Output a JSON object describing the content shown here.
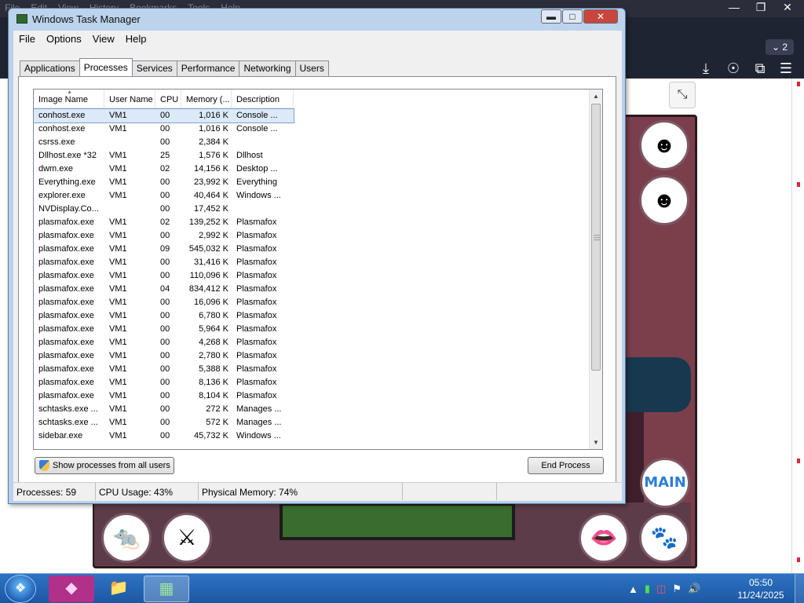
{
  "browser": {
    "menu": [
      "File",
      "Edit",
      "View",
      "History",
      "Bookmarks",
      "Tools",
      "Help"
    ],
    "tab_count": "2",
    "toolbar_icons": [
      "download-icon",
      "account-icon",
      "extensions-icon",
      "menu-icon"
    ]
  },
  "game": {
    "main_button_label": "MAIN"
  },
  "task_manager": {
    "title": "Windows Task Manager",
    "menu": [
      "File",
      "Options",
      "View",
      "Help"
    ],
    "tabs": [
      "Applications",
      "Processes",
      "Services",
      "Performance",
      "Networking",
      "Users"
    ],
    "active_tab": "Processes",
    "columns": [
      "Image Name",
      "User Name",
      "CPU",
      "Memory (...",
      "Description"
    ],
    "rows": [
      {
        "image": "conhost.exe",
        "user": "VM1",
        "cpu": "00",
        "memory": "1,016 K",
        "description": "Console ..."
      },
      {
        "image": "conhost.exe",
        "user": "VM1",
        "cpu": "00",
        "memory": "1,016 K",
        "description": "Console ..."
      },
      {
        "image": "csrss.exe",
        "user": "",
        "cpu": "00",
        "memory": "2,384 K",
        "description": ""
      },
      {
        "image": "Dllhost.exe *32",
        "user": "VM1",
        "cpu": "25",
        "memory": "1,576 K",
        "description": "Dllhost"
      },
      {
        "image": "dwm.exe",
        "user": "VM1",
        "cpu": "02",
        "memory": "14,156 K",
        "description": "Desktop ..."
      },
      {
        "image": "Everything.exe",
        "user": "VM1",
        "cpu": "00",
        "memory": "23,992 K",
        "description": "Everything"
      },
      {
        "image": "explorer.exe",
        "user": "VM1",
        "cpu": "00",
        "memory": "40,464 K",
        "description": "Windows ..."
      },
      {
        "image": "NVDisplay.Co...",
        "user": "",
        "cpu": "00",
        "memory": "17,452 K",
        "description": ""
      },
      {
        "image": "plasmafox.exe",
        "user": "VM1",
        "cpu": "02",
        "memory": "139,252 K",
        "description": "Plasmafox"
      },
      {
        "image": "plasmafox.exe",
        "user": "VM1",
        "cpu": "00",
        "memory": "2,992 K",
        "description": "Plasmafox"
      },
      {
        "image": "plasmafox.exe",
        "user": "VM1",
        "cpu": "09",
        "memory": "545,032 K",
        "description": "Plasmafox"
      },
      {
        "image": "plasmafox.exe",
        "user": "VM1",
        "cpu": "00",
        "memory": "31,416 K",
        "description": "Plasmafox"
      },
      {
        "image": "plasmafox.exe",
        "user": "VM1",
        "cpu": "00",
        "memory": "110,096 K",
        "description": "Plasmafox"
      },
      {
        "image": "plasmafox.exe",
        "user": "VM1",
        "cpu": "04",
        "memory": "834,412 K",
        "description": "Plasmafox"
      },
      {
        "image": "plasmafox.exe",
        "user": "VM1",
        "cpu": "00",
        "memory": "16,096 K",
        "description": "Plasmafox"
      },
      {
        "image": "plasmafox.exe",
        "user": "VM1",
        "cpu": "00",
        "memory": "6,780 K",
        "description": "Plasmafox"
      },
      {
        "image": "plasmafox.exe",
        "user": "VM1",
        "cpu": "00",
        "memory": "5,964 K",
        "description": "Plasmafox"
      },
      {
        "image": "plasmafox.exe",
        "user": "VM1",
        "cpu": "00",
        "memory": "4,268 K",
        "description": "Plasmafox"
      },
      {
        "image": "plasmafox.exe",
        "user": "VM1",
        "cpu": "00",
        "memory": "2,780 K",
        "description": "Plasmafox"
      },
      {
        "image": "plasmafox.exe",
        "user": "VM1",
        "cpu": "00",
        "memory": "5,388 K",
        "description": "Plasmafox"
      },
      {
        "image": "plasmafox.exe",
        "user": "VM1",
        "cpu": "00",
        "memory": "8,136 K",
        "description": "Plasmafox"
      },
      {
        "image": "plasmafox.exe",
        "user": "VM1",
        "cpu": "00",
        "memory": "8,104 K",
        "description": "Plasmafox"
      },
      {
        "image": "schtasks.exe ...",
        "user": "VM1",
        "cpu": "00",
        "memory": "272 K",
        "description": "Manages ..."
      },
      {
        "image": "schtasks.exe ...",
        "user": "VM1",
        "cpu": "00",
        "memory": "572 K",
        "description": "Manages ..."
      },
      {
        "image": "sidebar.exe",
        "user": "VM1",
        "cpu": "00",
        "memory": "45,732 K",
        "description": "Windows ..."
      }
    ],
    "show_all_label": "Show processes from all users",
    "end_process_label": "End Process",
    "status": {
      "processes": "Processes: 59",
      "cpu": "CPU Usage: 43%",
      "memory": "Physical Memory: 74%"
    }
  },
  "taskbar": {
    "apps": [
      "plasmafox-icon",
      "explorer-folder-icon",
      "task-manager-icon"
    ],
    "tray_icons": [
      "show-hidden-icons-icon",
      "battery-icon",
      "network-icon",
      "action-center-icon",
      "volume-icon"
    ],
    "time": "05:50",
    "date": "11/24/2025"
  }
}
